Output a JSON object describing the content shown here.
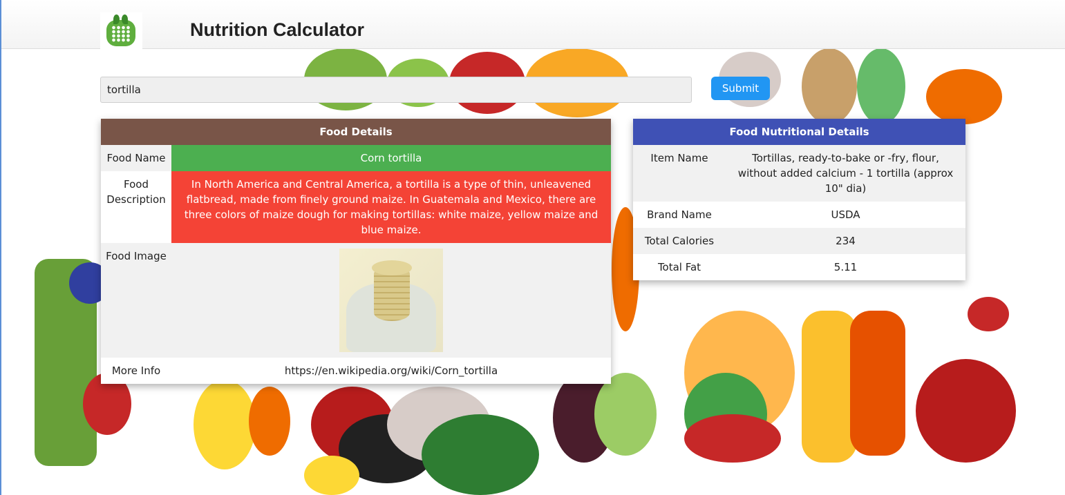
{
  "app": {
    "title": "Nutrition Calculator"
  },
  "search": {
    "value": "tortilla",
    "submit_label": "Submit"
  },
  "food_details": {
    "heading": "Food Details",
    "name_label": "Food Name",
    "name": "Corn tortilla",
    "description_label": "Food Description",
    "description": "In North America and Central America, a tortilla is a type of thin, unleavened flatbread, made from finely ground maize. In Guatemala and Mexico, there are three colors of maize dough for making tortillas: white maize, yellow maize and blue maize.",
    "image_label": "Food Image",
    "more_info_label": "More Info",
    "more_info": "https://en.wikipedia.org/wiki/Corn_tortilla"
  },
  "nutrition": {
    "heading": "Food Nutritional Details",
    "rows": [
      {
        "label": "Item Name",
        "value": "Tortillas, ready-to-bake or -fry, flour, without added calcium - 1 tortilla (approx 10\" dia)"
      },
      {
        "label": "Brand Name",
        "value": "USDA"
      },
      {
        "label": "Total Calories",
        "value": "234"
      },
      {
        "label": "Total Fat",
        "value": "5.11"
      }
    ]
  },
  "colors": {
    "details_header": "#795548",
    "nutrition_header": "#3f51b5",
    "name_cell": "#4caf50",
    "description_cell": "#f44336",
    "submit": "#2196f3"
  }
}
